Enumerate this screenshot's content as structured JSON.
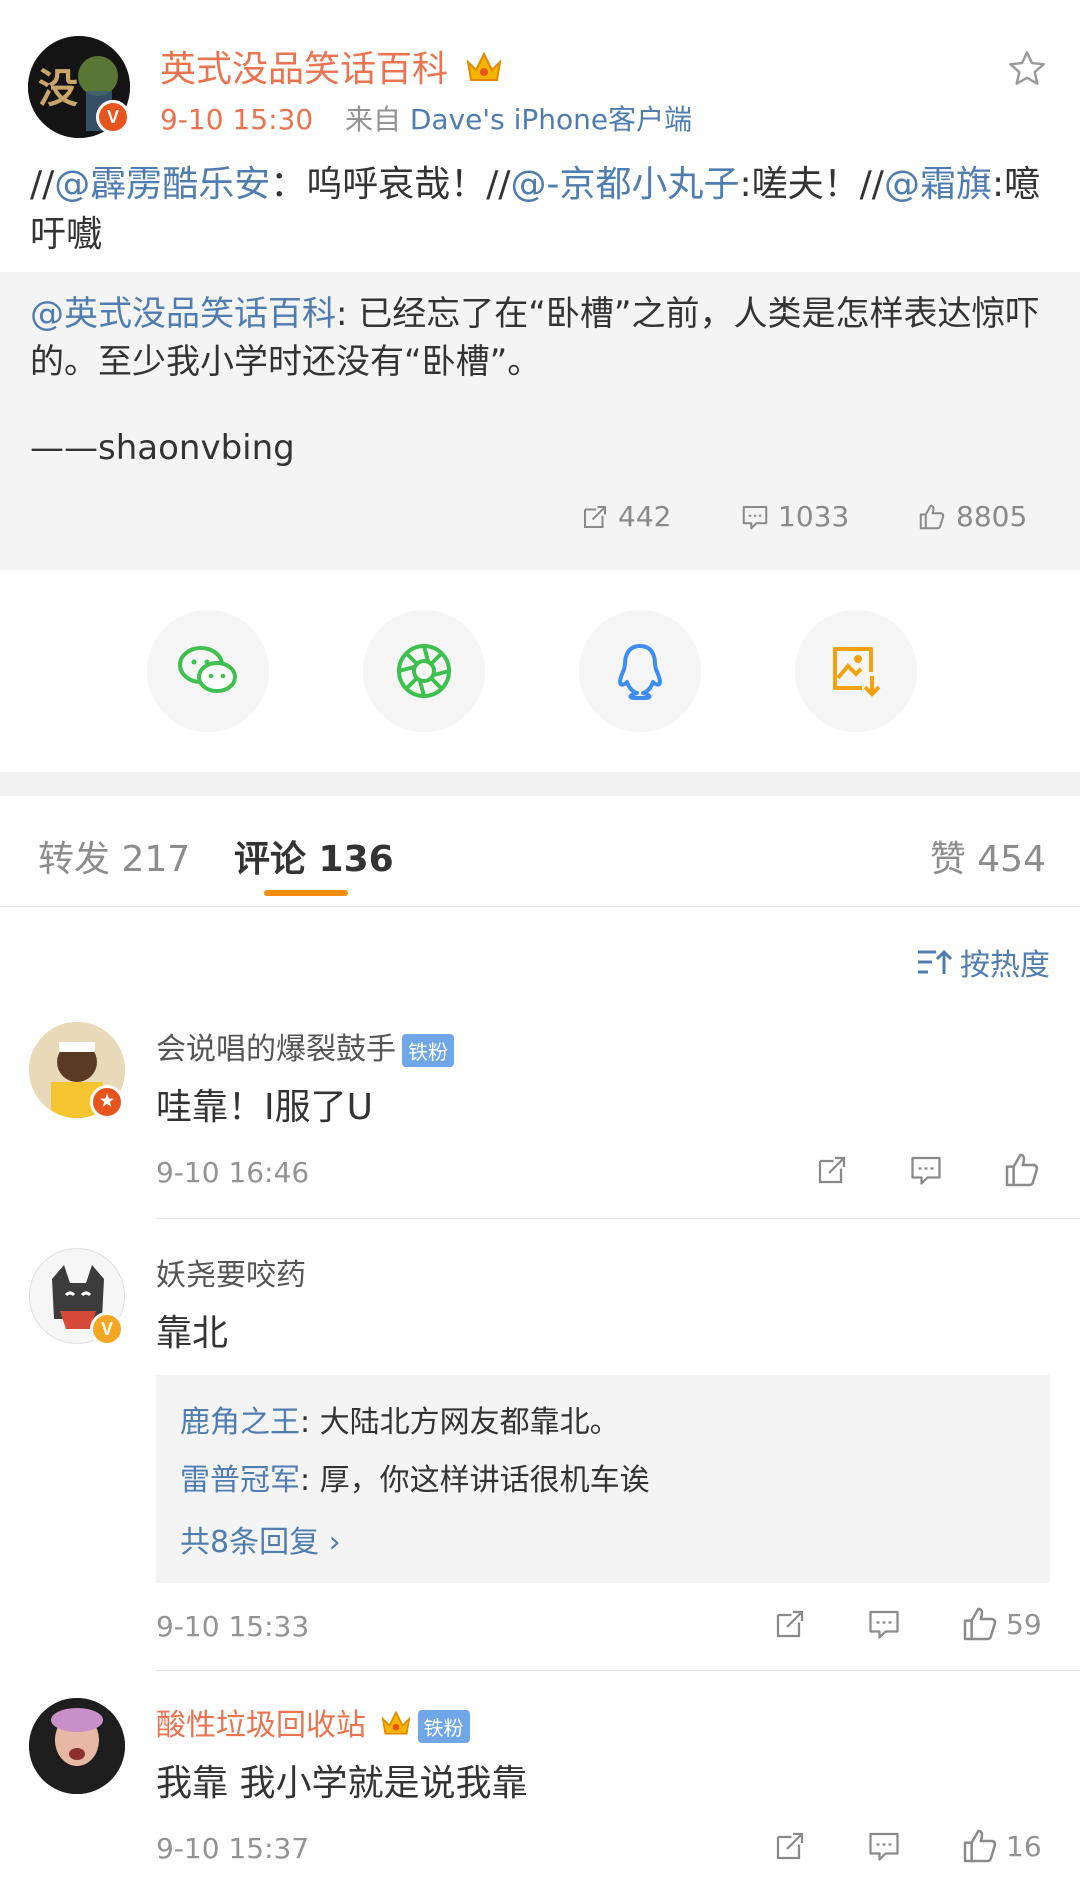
{
  "post": {
    "author": "英式没品笑话百科",
    "time": "9-10 15:30",
    "source_prefix": "来自",
    "source": "Dave's iPhone客户端",
    "text_parts": [
      {
        "t": "//",
        "link": false
      },
      {
        "t": "@霹雳酷乐安",
        "link": true
      },
      {
        "t": "：呜呼哀哉！//",
        "link": false
      },
      {
        "t": "@-京都小丸子",
        "link": true
      },
      {
        "t": ":嗟夫！//",
        "link": false
      },
      {
        "t": "@霜旗",
        "link": true
      },
      {
        "t": ":噫吁嚱",
        "link": false
      }
    ],
    "repost": {
      "author": "@英式没品笑话百科",
      "text": ": 已经忘了在“卧槽”之前，人类是怎样表达惊吓的。至少我小学时还没有“卧槽”。",
      "signature": "——shaonvbing",
      "stats": {
        "repost": "442",
        "comment": "1033",
        "like": "8805"
      }
    }
  },
  "share": [
    {
      "name": "wechat-icon",
      "color": "#3ec04f"
    },
    {
      "name": "moments-icon",
      "color": "#3ec04f"
    },
    {
      "name": "qq-icon",
      "color": "#3d8ef0"
    },
    {
      "name": "save-image-icon",
      "color": "#f2a20e"
    }
  ],
  "tabs": {
    "repost": "转发 217",
    "comment": "评论 136",
    "like": "赞 454"
  },
  "sort_label": "按热度",
  "comments": [
    {
      "name": "会说唱的爆裂鼓手",
      "badge": "铁粉",
      "text": "哇靠！I服了U",
      "time": "9-10 16:46",
      "likes": ""
    },
    {
      "name": "妖尧要咬药",
      "badge": "",
      "text": "靠北",
      "time": "9-10 15:33",
      "likes": "59",
      "replies": [
        {
          "author": "鹿角之王",
          "text": ": 大陆北方网友都靠北。"
        },
        {
          "author": "雷普冠军",
          "text": ": 厚，你这样讲话很机车诶"
        }
      ],
      "more": "共8条回复 ›"
    },
    {
      "name": "酸性垃圾回收站",
      "badge": "铁粉",
      "text": "我靠 我小学就是说我靠",
      "time": "9-10 15:37",
      "likes": "16"
    }
  ],
  "colors": {
    "accent": "#eb7350",
    "link": "#507daf",
    "tab_underline": "#f28c0e"
  }
}
